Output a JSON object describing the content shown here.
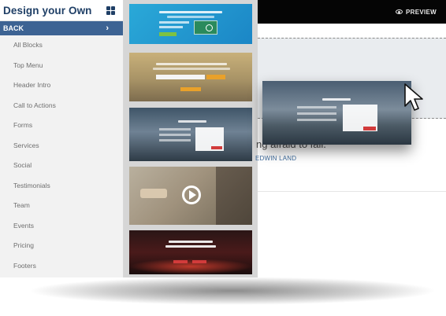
{
  "sidebar": {
    "title": "Design your Own",
    "back_label": "BACK",
    "items": [
      {
        "label": "All Blocks"
      },
      {
        "label": "Top Menu"
      },
      {
        "label": "Header Intro"
      },
      {
        "label": "Call to Actions"
      },
      {
        "label": "Forms"
      },
      {
        "label": "Services"
      },
      {
        "label": "Social"
      },
      {
        "label": "Testimonials"
      },
      {
        "label": "Team"
      },
      {
        "label": "Events"
      },
      {
        "label": "Pricing"
      },
      {
        "label": "Footers"
      }
    ]
  },
  "toolbar": {
    "preview_label": "PREVIEW"
  },
  "canvas": {
    "quote_text": "ng afraid to fail.",
    "author_text": "EDWIN LAND"
  },
  "icons": {
    "grid": "grid-icon",
    "chevron": "chevron-right-icon",
    "eye": "eye-icon",
    "play": "play-icon",
    "cursor": "cursor-icon"
  },
  "colors": {
    "sidebar_title": "#1f3f66",
    "back_bar": "#3d6393",
    "topbar": "#050505",
    "author_link": "#3d6b9c"
  }
}
